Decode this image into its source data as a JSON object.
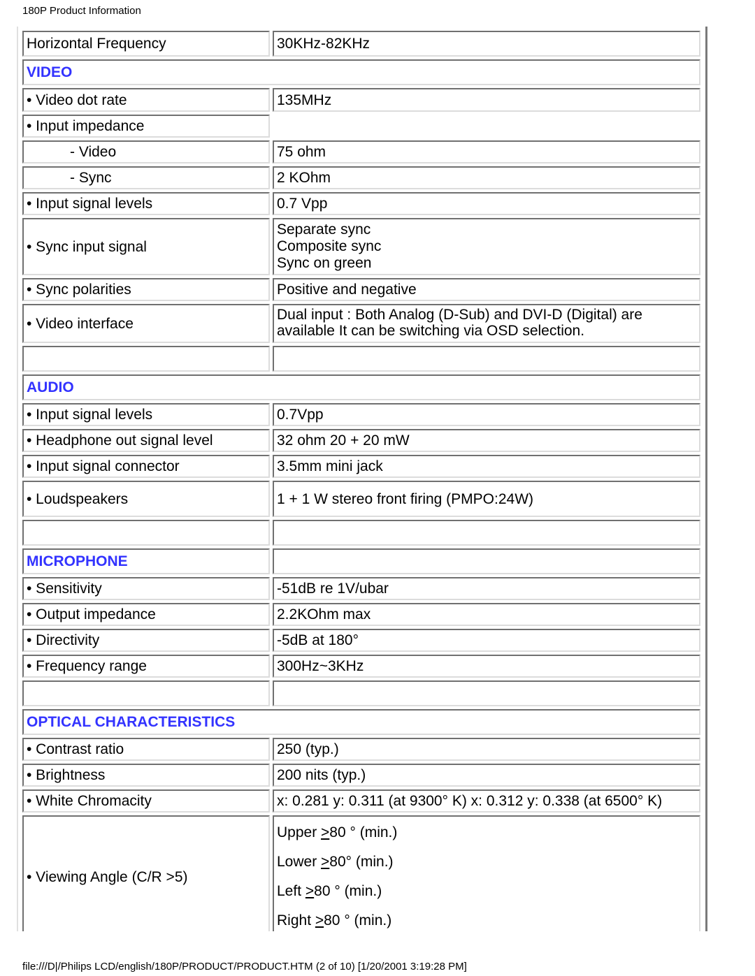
{
  "header": {
    "title": "180P Product Information"
  },
  "footer": {
    "path": "file:///D|/Philips LCD/english/180P/PRODUCT/PRODUCT.HTM (2 of 10) [1/20/2001 3:19:28 PM]"
  },
  "top_row": {
    "label": "Horizontal Frequency",
    "value": "30KHz-82KHz"
  },
  "sections": {
    "video": {
      "title": "VIDEO",
      "rows": [
        {
          "label": "• Video dot rate",
          "value": "135MHz"
        },
        {
          "label": "• Input impedance",
          "value": ""
        },
        {
          "label": "- Video",
          "value": "75 ohm"
        },
        {
          "label": "- Sync",
          "value": "2 KOhm"
        },
        {
          "label": "• Input signal levels",
          "value": "0.7 Vpp"
        },
        {
          "label": "• Sync input signal",
          "values": [
            "Separate sync",
            "Composite sync",
            "Sync on green"
          ]
        },
        {
          "label": "• Sync polarities",
          "value": "Positive and negative"
        },
        {
          "label": "• Video interface",
          "value": "Dual input : Both Analog (D-Sub) and DVI-D (Digital) are available It can be switching via OSD selection."
        }
      ]
    },
    "audio": {
      "title": "AUDIO",
      "rows": [
        {
          "label": "• Input signal levels",
          "value": "0.7Vpp"
        },
        {
          "label": "• Headphone out signal level",
          "value": "32 ohm 20 + 20 mW"
        },
        {
          "label": "• Input signal connector",
          "value": "3.5mm mini jack"
        },
        {
          "label": "• Loudspeakers",
          "value": "1 + 1 W stereo front firing (PMPO:24W)"
        }
      ]
    },
    "microphone": {
      "title": "MICROPHONE",
      "rows": [
        {
          "label": "• Sensitivity",
          "value": "-51dB re 1V/ubar"
        },
        {
          "label": "• Output impedance",
          "value": "2.2KOhm max"
        },
        {
          "label": "• Directivity",
          "value": "-5dB at 180°"
        },
        {
          "label": "• Frequency range",
          "value": "300Hz~3KHz"
        }
      ]
    },
    "optical": {
      "title": "OPTICAL CHARACTERISTICS",
      "rows": [
        {
          "label": "• Contrast ratio",
          "value": "250 (typ.)"
        },
        {
          "label": "• Brightness",
          "value": "200 nits (typ.)"
        },
        {
          "label": "• White Chromacity",
          "value": "x: 0.281 y: 0.311 (at 9300° K) x: 0.312 y: 0.338 (at 6500° K)"
        },
        {
          "label": "• Viewing Angle (C/R >5)",
          "angles": [
            {
              "pre": "Upper ",
              "sym": ">",
              "post": "80 ° (min.)"
            },
            {
              "pre": "Lower ",
              "sym": ">",
              "post": "80° (min.)"
            },
            {
              "pre": "Left ",
              "sym": ">",
              "post": "80 ° (min.)"
            },
            {
              "pre": "Right ",
              "sym": ">",
              "post": "80 ° (min.)"
            }
          ]
        }
      ]
    }
  },
  "colors": {
    "section_heading": "#3333ff"
  }
}
